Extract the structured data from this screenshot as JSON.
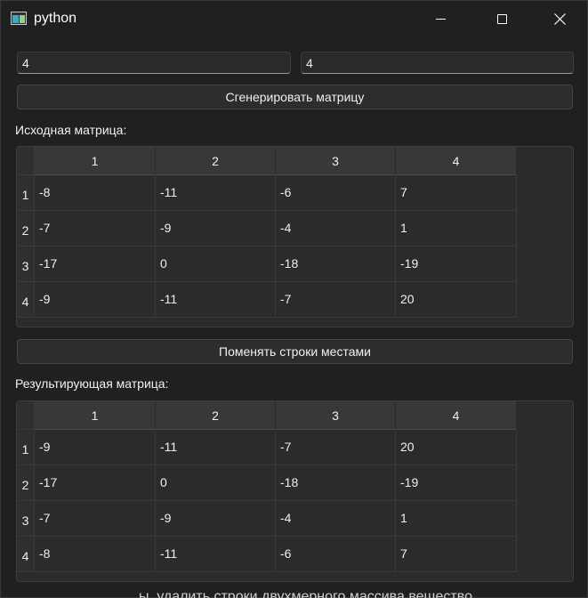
{
  "window": {
    "title": "python",
    "icon": "python-app-icon"
  },
  "title_bar_buttons": {
    "minimize": "minimize-icon",
    "maximize": "maximize-icon",
    "close": "close-icon"
  },
  "inputs": {
    "rows_value": "4",
    "cols_value": "4"
  },
  "buttons": {
    "generate_label": "Сгенерировать матрицу",
    "swap_label": "Поменять строки местами"
  },
  "source": {
    "label": "Исходная матрица:",
    "columns": [
      "1",
      "2",
      "3",
      "4"
    ],
    "row_headers": [
      "1",
      "2",
      "3",
      "4"
    ],
    "rows": [
      [
        "-8",
        "-11",
        "-6",
        "7"
      ],
      [
        "-7",
        "-9",
        "-4",
        "1"
      ],
      [
        "-17",
        "0",
        "-18",
        "-19"
      ],
      [
        "-9",
        "-11",
        "-7",
        "20"
      ]
    ]
  },
  "result": {
    "label": "Результирующая матрица:",
    "columns": [
      "1",
      "2",
      "3",
      "4"
    ],
    "row_headers": [
      "1",
      "2",
      "3",
      "4"
    ],
    "rows": [
      [
        "-9",
        "-11",
        "-7",
        "20"
      ],
      [
        "-17",
        "0",
        "-18",
        "-19"
      ],
      [
        "-7",
        "-9",
        "-4",
        "1"
      ],
      [
        "-8",
        "-11",
        "-6",
        "7"
      ]
    ]
  },
  "background_text": "…ы, удалить строки двухмерного массива вещество",
  "colors": {
    "window_bg": "#202020",
    "table_bg": "#2b2b2b",
    "header_bg": "#383838",
    "text": "#f0f0f0"
  }
}
